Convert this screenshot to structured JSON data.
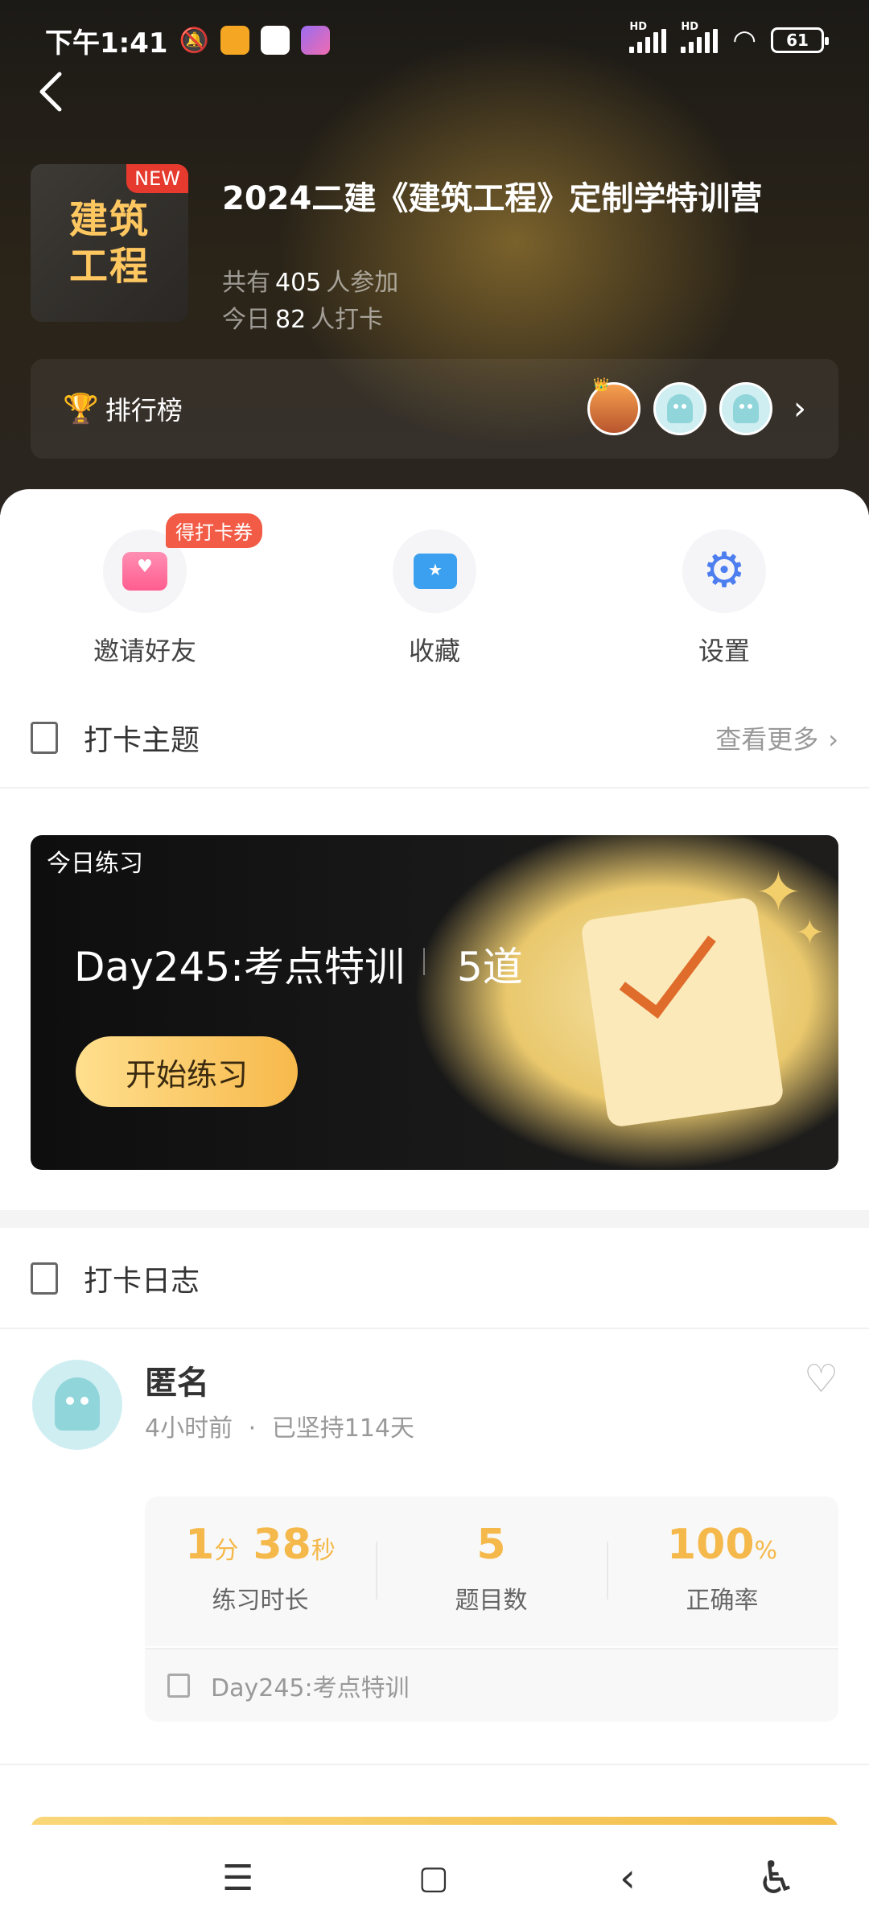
{
  "status_bar": {
    "time": "下午1:41",
    "battery": "61",
    "signal_label_1": "HD",
    "signal_label_2": "HD"
  },
  "header": {
    "back_icon": "chevron-left-icon",
    "cover_text_line1": "建筑",
    "cover_text_line2": "工程",
    "new_badge": "NEW",
    "course_title": "2024二建《建筑工程》定制学特训营",
    "participants_prefix": "共有",
    "participants_count": "405",
    "participants_suffix": "人参加",
    "checkin_prefix": "今日",
    "checkin_count": "82",
    "checkin_suffix": "人打卡",
    "ranking_label": "排行榜"
  },
  "quick_actions": {
    "invite_label": "邀请好友",
    "invite_badge": "得打卡券",
    "favorites_label": "收藏",
    "settings_label": "设置"
  },
  "topics_section": {
    "title": "打卡主题",
    "more_label": "查看更多"
  },
  "practice_card": {
    "tag": "今日练习",
    "title": "Day245:考点特训",
    "question_count": "5道",
    "start_button": "开始练习"
  },
  "log_section": {
    "title": "打卡日志"
  },
  "log_entry": {
    "name": "匿名",
    "time_ago": "4小时前",
    "dot": "·",
    "streak": "已坚持114天",
    "duration_min": "1",
    "duration_min_unit": "分",
    "duration_sec": "38",
    "duration_sec_unit": "秒",
    "duration_label": "练习时长",
    "question_num": "5",
    "question_label": "题目数",
    "accuracy": "100",
    "accuracy_unit": "%",
    "accuracy_label": "正确率",
    "topic": "Day245:考点特训"
  },
  "colors": {
    "accent_gold": "#f5b84a",
    "badge_red": "#f25b45",
    "new_red": "#e63a2e"
  }
}
